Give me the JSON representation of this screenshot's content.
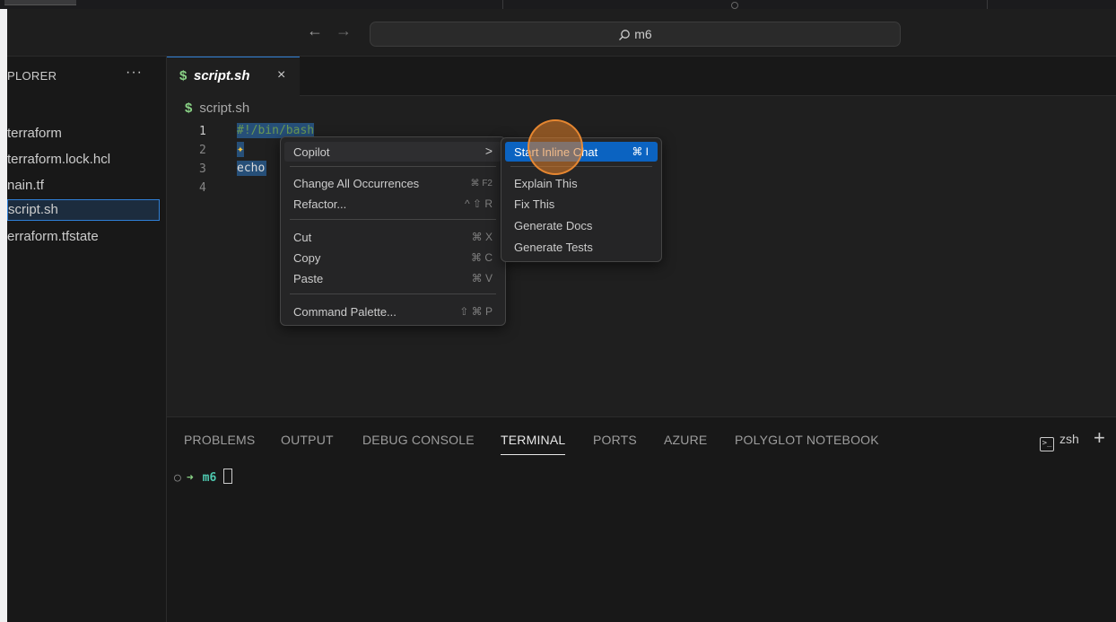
{
  "titlebar": {
    "back": "←",
    "forward": "→",
    "search_text": "m6"
  },
  "sidebar": {
    "title": "PLORER",
    "more": "···",
    "items": [
      {
        "label": "terraform"
      },
      {
        "label": "terraform.lock.hcl"
      },
      {
        "label": "nain.tf"
      },
      {
        "label": "script.sh"
      },
      {
        "label": "erraform.tfstate"
      }
    ]
  },
  "tab": {
    "icon": "$",
    "name": "script.sh",
    "close": "×"
  },
  "breadcrumb": {
    "icon": "$",
    "file": "script.sh"
  },
  "editor": {
    "lines": [
      {
        "num": "1",
        "text": "#!/bin/bash"
      },
      {
        "num": "2",
        "text": "✦"
      },
      {
        "num": "3",
        "text": "echo"
      },
      {
        "num": "4",
        "text": ""
      }
    ]
  },
  "context_menu": {
    "copilot": "Copilot",
    "copilot_chevron": ">",
    "change_all": "Change All Occurrences",
    "change_all_kb": "⌘ F2",
    "refactor": "Refactor...",
    "refactor_kb": "^ ⇧ R",
    "cut": "Cut",
    "cut_kb": "⌘ X",
    "copy": "Copy",
    "copy_kb": "⌘ C",
    "paste": "Paste",
    "paste_kb": "⌘ V",
    "command_palette": "Command Palette...",
    "command_palette_kb": "⇧ ⌘ P"
  },
  "submenu": {
    "start_inline_chat": "Start Inline Chat",
    "start_inline_chat_kb": "⌘ I",
    "explain": "Explain This",
    "fix": "Fix This",
    "docs": "Generate Docs",
    "tests": "Generate Tests"
  },
  "panel": {
    "tabs": [
      "PROBLEMS",
      "OUTPUT",
      "DEBUG CONSOLE",
      "TERMINAL",
      "PORTS",
      "AZURE",
      "POLYGLOT NOTEBOOK"
    ],
    "active_tab": "TERMINAL",
    "shell_icon": ">_",
    "shell": "zsh",
    "add": "+"
  },
  "terminal": {
    "circle": "○",
    "arrow": "➜",
    "dir": "m6"
  },
  "colors": {
    "accent": "#0b63c1",
    "selection": "#264f78",
    "click_marker": "#e28028"
  }
}
